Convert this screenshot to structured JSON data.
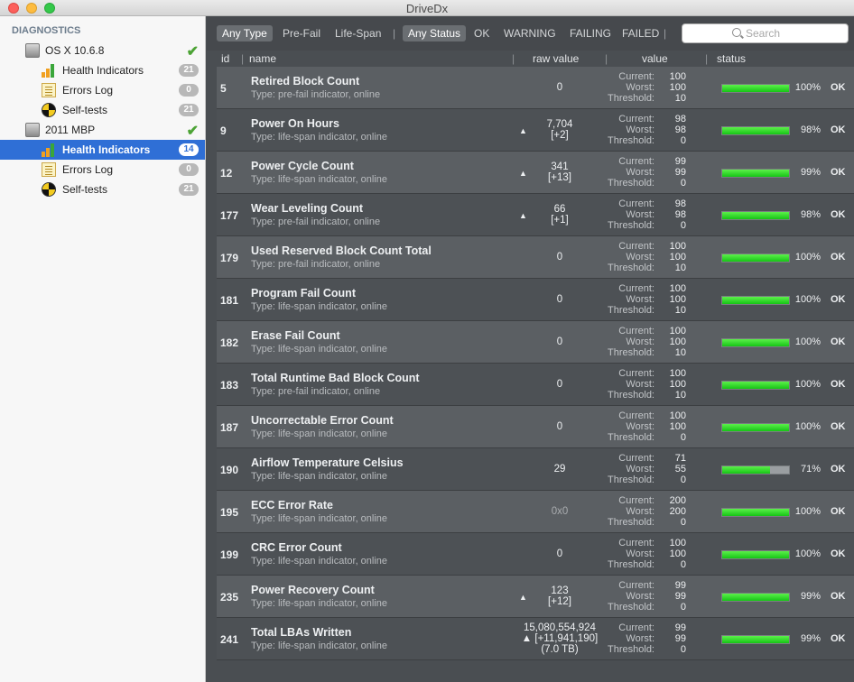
{
  "window": {
    "title": "DriveDx"
  },
  "sidebar": {
    "header": "DIAGNOSTICS",
    "drives": [
      {
        "name": "OS X 10.6.8",
        "status_icon": "green-check",
        "items": [
          {
            "label": "Health Indicators",
            "badge": "21"
          },
          {
            "label": "Errors Log",
            "badge": "0"
          },
          {
            "label": "Self-tests",
            "badge": "21"
          }
        ]
      },
      {
        "name": "2011 MBP",
        "status_icon": "green-check",
        "items": [
          {
            "label": "Health Indicators",
            "badge": "14",
            "selected": true
          },
          {
            "label": "Errors Log",
            "badge": "0"
          },
          {
            "label": "Self-tests",
            "badge": "21"
          }
        ]
      }
    ]
  },
  "filters": {
    "type": [
      "Any Type",
      "Pre-Fail",
      "Life-Span"
    ],
    "status": [
      "Any Status",
      "OK",
      "WARNING",
      "FAILING",
      "FAILED"
    ],
    "separator": "|",
    "search_placeholder": "Search"
  },
  "columns": {
    "id": "id",
    "name": "name",
    "raw": "raw value",
    "value": "value",
    "status": "status"
  },
  "labels": {
    "current": "Current:",
    "worst": "Worst:",
    "threshold": "Threshold:",
    "arrow": "▲"
  },
  "colors": {
    "accent": "#2f6fd6",
    "bar_green": "#22d01e",
    "ok": "#ffffff"
  },
  "rows": [
    {
      "id": "5",
      "name": "Retired Block Count",
      "type": "Type: pre-fail indicator, online",
      "raw": [
        "0"
      ],
      "arrow": false,
      "current": "100",
      "worst": "100",
      "threshold": "10",
      "pct": "100%",
      "fill": 1.0,
      "status": "OK"
    },
    {
      "id": "9",
      "name": "Power On Hours",
      "type": "Type: life-span indicator, online",
      "raw": [
        "7,704",
        "[+2]"
      ],
      "arrow": true,
      "current": "98",
      "worst": "98",
      "threshold": "0",
      "pct": "98%",
      "fill": 1.0,
      "status": "OK"
    },
    {
      "id": "12",
      "name": "Power Cycle Count",
      "type": "Type: life-span indicator, online",
      "raw": [
        "341",
        "[+13]"
      ],
      "arrow": true,
      "current": "99",
      "worst": "99",
      "threshold": "0",
      "pct": "99%",
      "fill": 1.0,
      "status": "OK"
    },
    {
      "id": "177",
      "name": "Wear Leveling Count",
      "type": "Type: pre-fail indicator, online",
      "raw": [
        "66",
        "[+1]"
      ],
      "arrow": true,
      "current": "98",
      "worst": "98",
      "threshold": "0",
      "pct": "98%",
      "fill": 1.0,
      "status": "OK"
    },
    {
      "id": "179",
      "name": "Used Reserved Block Count Total",
      "type": "Type: pre-fail indicator, online",
      "raw": [
        "0"
      ],
      "arrow": false,
      "current": "100",
      "worst": "100",
      "threshold": "10",
      "pct": "100%",
      "fill": 1.0,
      "status": "OK"
    },
    {
      "id": "181",
      "name": "Program Fail Count",
      "type": "Type: life-span indicator, online",
      "raw": [
        "0"
      ],
      "arrow": false,
      "current": "100",
      "worst": "100",
      "threshold": "10",
      "pct": "100%",
      "fill": 1.0,
      "status": "OK"
    },
    {
      "id": "182",
      "name": "Erase Fail Count",
      "type": "Type: life-span indicator, online",
      "raw": [
        "0"
      ],
      "arrow": false,
      "current": "100",
      "worst": "100",
      "threshold": "10",
      "pct": "100%",
      "fill": 1.0,
      "status": "OK"
    },
    {
      "id": "183",
      "name": "Total Runtime Bad Block Count",
      "type": "Type: pre-fail indicator, online",
      "raw": [
        "0"
      ],
      "arrow": false,
      "current": "100",
      "worst": "100",
      "threshold": "10",
      "pct": "100%",
      "fill": 1.0,
      "status": "OK"
    },
    {
      "id": "187",
      "name": "Uncorrectable Error Count",
      "type": "Type: life-span indicator, online",
      "raw": [
        "0"
      ],
      "arrow": false,
      "current": "100",
      "worst": "100",
      "threshold": "0",
      "pct": "100%",
      "fill": 1.0,
      "status": "OK"
    },
    {
      "id": "190",
      "name": "Airflow Temperature Celsius",
      "type": "Type: life-span indicator, online",
      "raw": [
        "29"
      ],
      "arrow": false,
      "current": "71",
      "worst": "55",
      "threshold": "0",
      "pct": "71%",
      "fill": 0.71,
      "status": "OK"
    },
    {
      "id": "195",
      "name": "ECC Error Rate",
      "type": "Type: life-span indicator, online",
      "raw": [
        "0x0"
      ],
      "arrow": false,
      "dim": true,
      "current": "200",
      "worst": "200",
      "threshold": "0",
      "pct": "100%",
      "fill": 1.0,
      "status": "OK"
    },
    {
      "id": "199",
      "name": "CRC Error Count",
      "type": "Type: life-span indicator, online",
      "raw": [
        "0"
      ],
      "arrow": false,
      "current": "100",
      "worst": "100",
      "threshold": "0",
      "pct": "100%",
      "fill": 1.0,
      "status": "OK"
    },
    {
      "id": "235",
      "name": "Power Recovery Count",
      "type": "Type: life-span indicator, online",
      "raw": [
        "123",
        "[+12]"
      ],
      "arrow": true,
      "current": "99",
      "worst": "99",
      "threshold": "0",
      "pct": "99%",
      "fill": 1.0,
      "status": "OK"
    },
    {
      "id": "241",
      "name": "Total LBAs Written",
      "type": "Type: life-span indicator, online",
      "raw": [
        "15,080,554,924",
        "▲ [+11,941,190]",
        "(7.0 TB)"
      ],
      "arrow": false,
      "current": "99",
      "worst": "99",
      "threshold": "0",
      "pct": "99%",
      "fill": 1.0,
      "status": "OK"
    }
  ]
}
